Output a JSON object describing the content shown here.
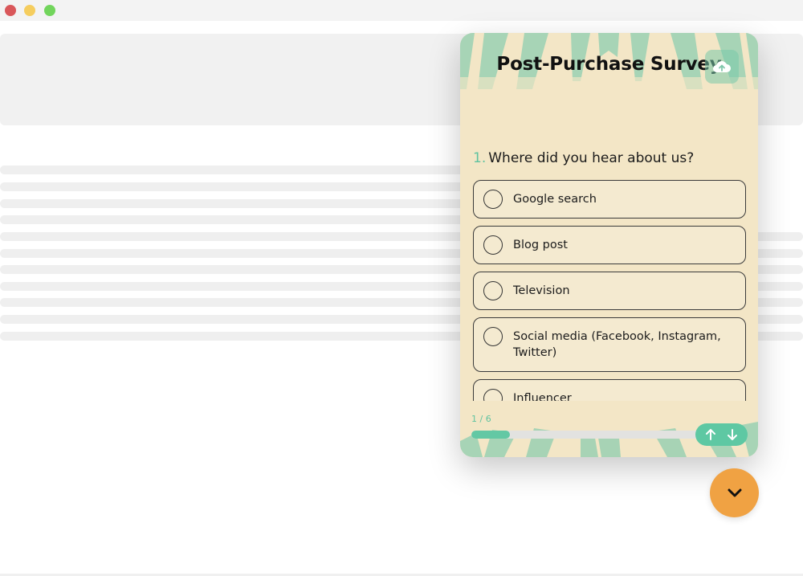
{
  "survey": {
    "title": "Post-Purchase Survey",
    "question_number": "1.",
    "question_text": "Where did you hear about us?",
    "options": [
      {
        "label": "Google search"
      },
      {
        "label": "Blog post"
      },
      {
        "label": "Television"
      },
      {
        "label": "Social media (Facebook, Instagram, Twitter)"
      },
      {
        "label": "Influencer"
      }
    ],
    "progress_text": "1 / 6",
    "progress_fraction": 0.167
  },
  "icons": {
    "upload": "cloud-upload-icon",
    "prev": "arrow-up-icon",
    "next": "arrow-down-icon",
    "collapse": "chevron-down-icon"
  },
  "colors": {
    "widget_bg": "#f3e6c6",
    "accent": "#5ec8a3",
    "fab": "#f0a243"
  }
}
